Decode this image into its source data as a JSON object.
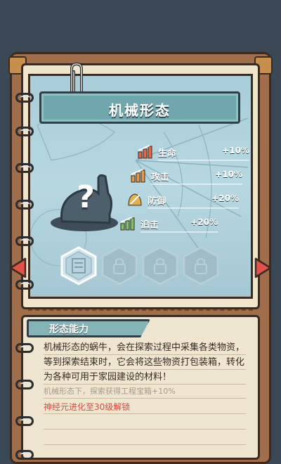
{
  "form": {
    "title": "机械形态",
    "stats": [
      {
        "label": "生命",
        "value": "+10%"
      },
      {
        "label": "攻击",
        "value": "+10%"
      },
      {
        "label": "防御",
        "value": "+20%"
      },
      {
        "label": "追击",
        "value": "+20%"
      }
    ],
    "mystery_symbol": "?"
  },
  "ability": {
    "tab_label": "形态能力",
    "description": "机械形态的蜗牛，会在探索过程中采集各类物资，等到探索结束时，它会将这些物资打包装箱，转化为各种可用于家园建设的材料！",
    "bonus": "机械形态下，探索获得工程宝箱+10%",
    "unlock": "神经元进化至30级解锁"
  },
  "colors": {
    "panel_blue": "#a9cdd9",
    "title_teal": "#6fa7ad",
    "book_brown": "#a06e4a",
    "page_cream": "#efe4cc",
    "arrow_red": "#e0524a",
    "unlock_red": "#d8493c"
  },
  "icons": {
    "stat_icon": "upgrade-arrow-icon",
    "slot_selected": "glyph-badge-icon",
    "slot_locked": "lock-icon",
    "nav_prev": "arrow-left-icon",
    "nav_next": "arrow-right-icon",
    "clip": "paperclip-icon"
  }
}
